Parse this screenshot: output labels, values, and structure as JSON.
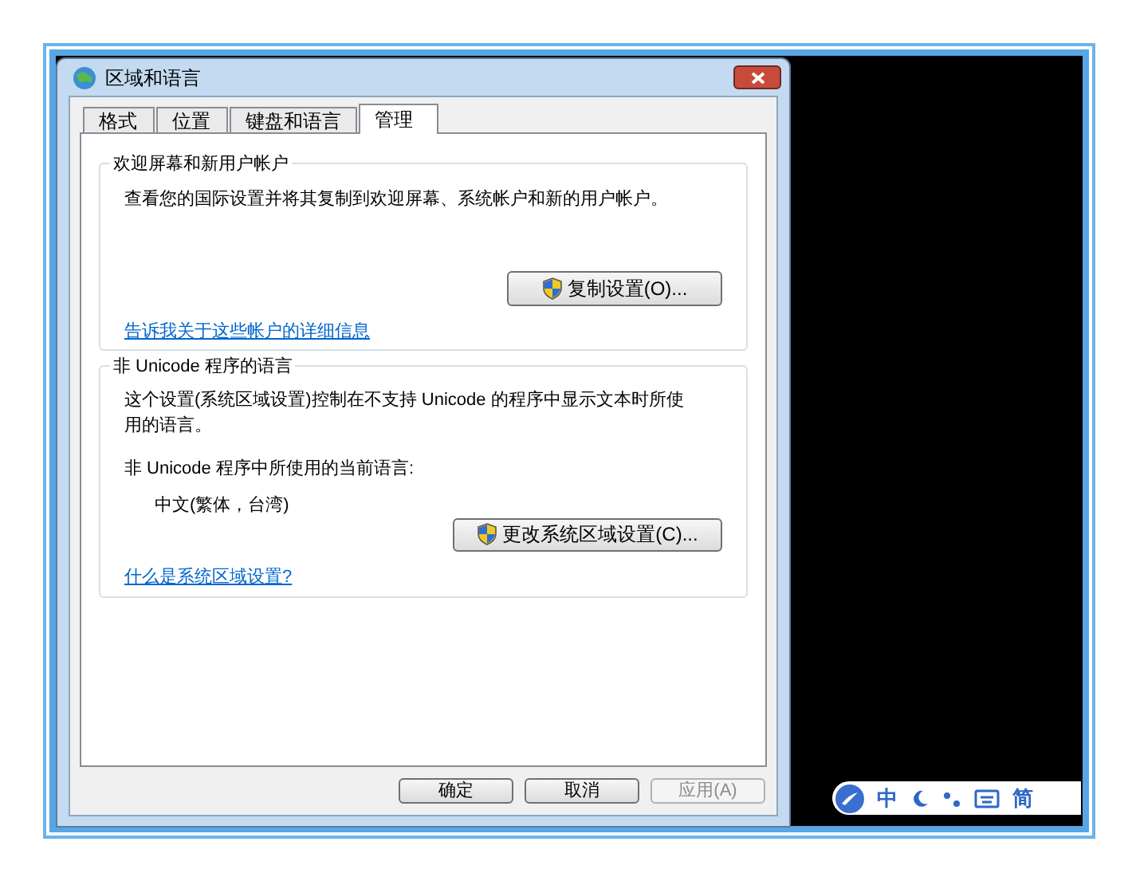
{
  "window": {
    "title": "区域和语言"
  },
  "tabs": [
    {
      "label": "格式",
      "selected": false
    },
    {
      "label": "位置",
      "selected": false
    },
    {
      "label": "键盘和语言",
      "selected": false
    },
    {
      "label": "管理",
      "selected": true
    }
  ],
  "groups": [
    {
      "title": "欢迎屏幕和新用户帐户",
      "description": "查看您的国际设置并将其复制到欢迎屏幕、系统帐户和新的用户帐户。",
      "button": {
        "label": "复制设置(O)...",
        "shield": true
      },
      "link": "告诉我关于这些帐户的详细信息"
    },
    {
      "title": "非 Unicode 程序的语言",
      "description": "这个设置(系统区域设置)控制在不支持 Unicode 的程序中显示文本时所使用的语言。",
      "current_language_label": "非 Unicode 程序中所使用的当前语言:",
      "current_language": "中文(繁体，台湾)",
      "button": {
        "label": "更改系统区域设置(C)...",
        "shield": true
      },
      "link": "什么是系统区域设置?"
    }
  ],
  "footer_buttons": [
    {
      "label": "确定",
      "disabled": false
    },
    {
      "label": "取消",
      "disabled": false
    },
    {
      "label": "应用(A)",
      "disabled": true
    }
  ],
  "language_bar": {
    "input_mode": "中",
    "script": "简"
  }
}
